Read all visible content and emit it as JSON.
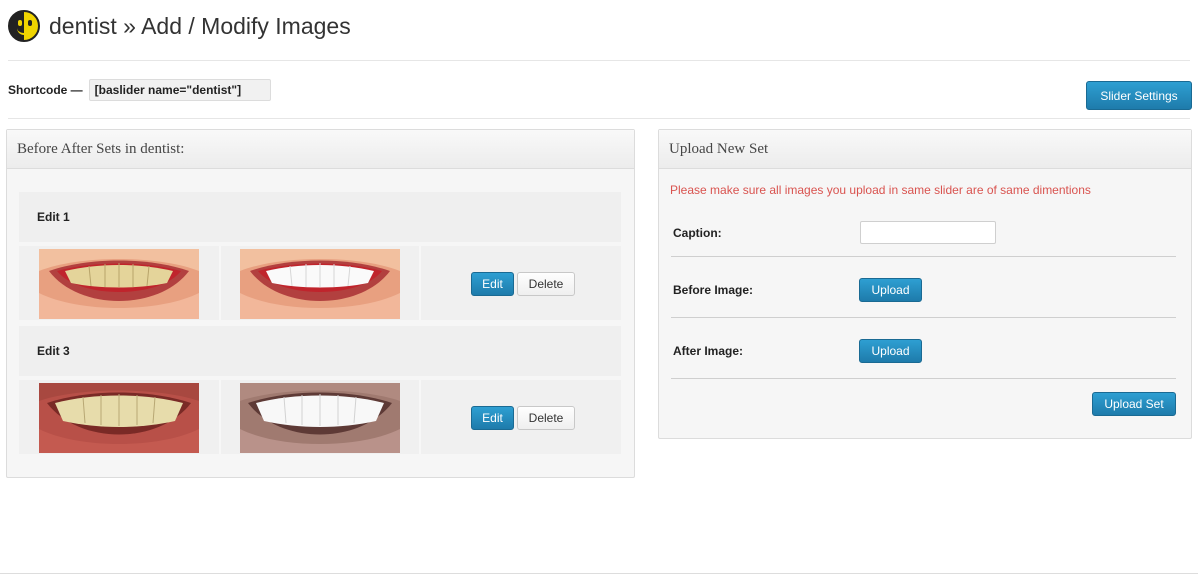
{
  "page": {
    "title": "dentist » Add / Modify Images"
  },
  "shortcode": {
    "label": "Shortcode —",
    "value": "[baslider name=\"dentist\"]"
  },
  "toolbar": {
    "slider_settings_label": "Slider Settings"
  },
  "sets_panel": {
    "title": "Before After Sets in dentist:",
    "sets": [
      {
        "name": "Edit 1",
        "edit_label": "Edit",
        "delete_label": "Delete"
      },
      {
        "name": "Edit 3",
        "edit_label": "Edit",
        "delete_label": "Delete"
      }
    ]
  },
  "upload_panel": {
    "title": "Upload New Set",
    "warning": "Please make sure all images you upload in same slider are of same dimentions",
    "caption_label": "Caption:",
    "caption_value": "",
    "before_label": "Before Image:",
    "after_label": "After Image:",
    "upload_label": "Upload",
    "upload_set_label": "Upload Set"
  },
  "colors": {
    "accent": "#2583b5",
    "warning": "#d9534f"
  }
}
